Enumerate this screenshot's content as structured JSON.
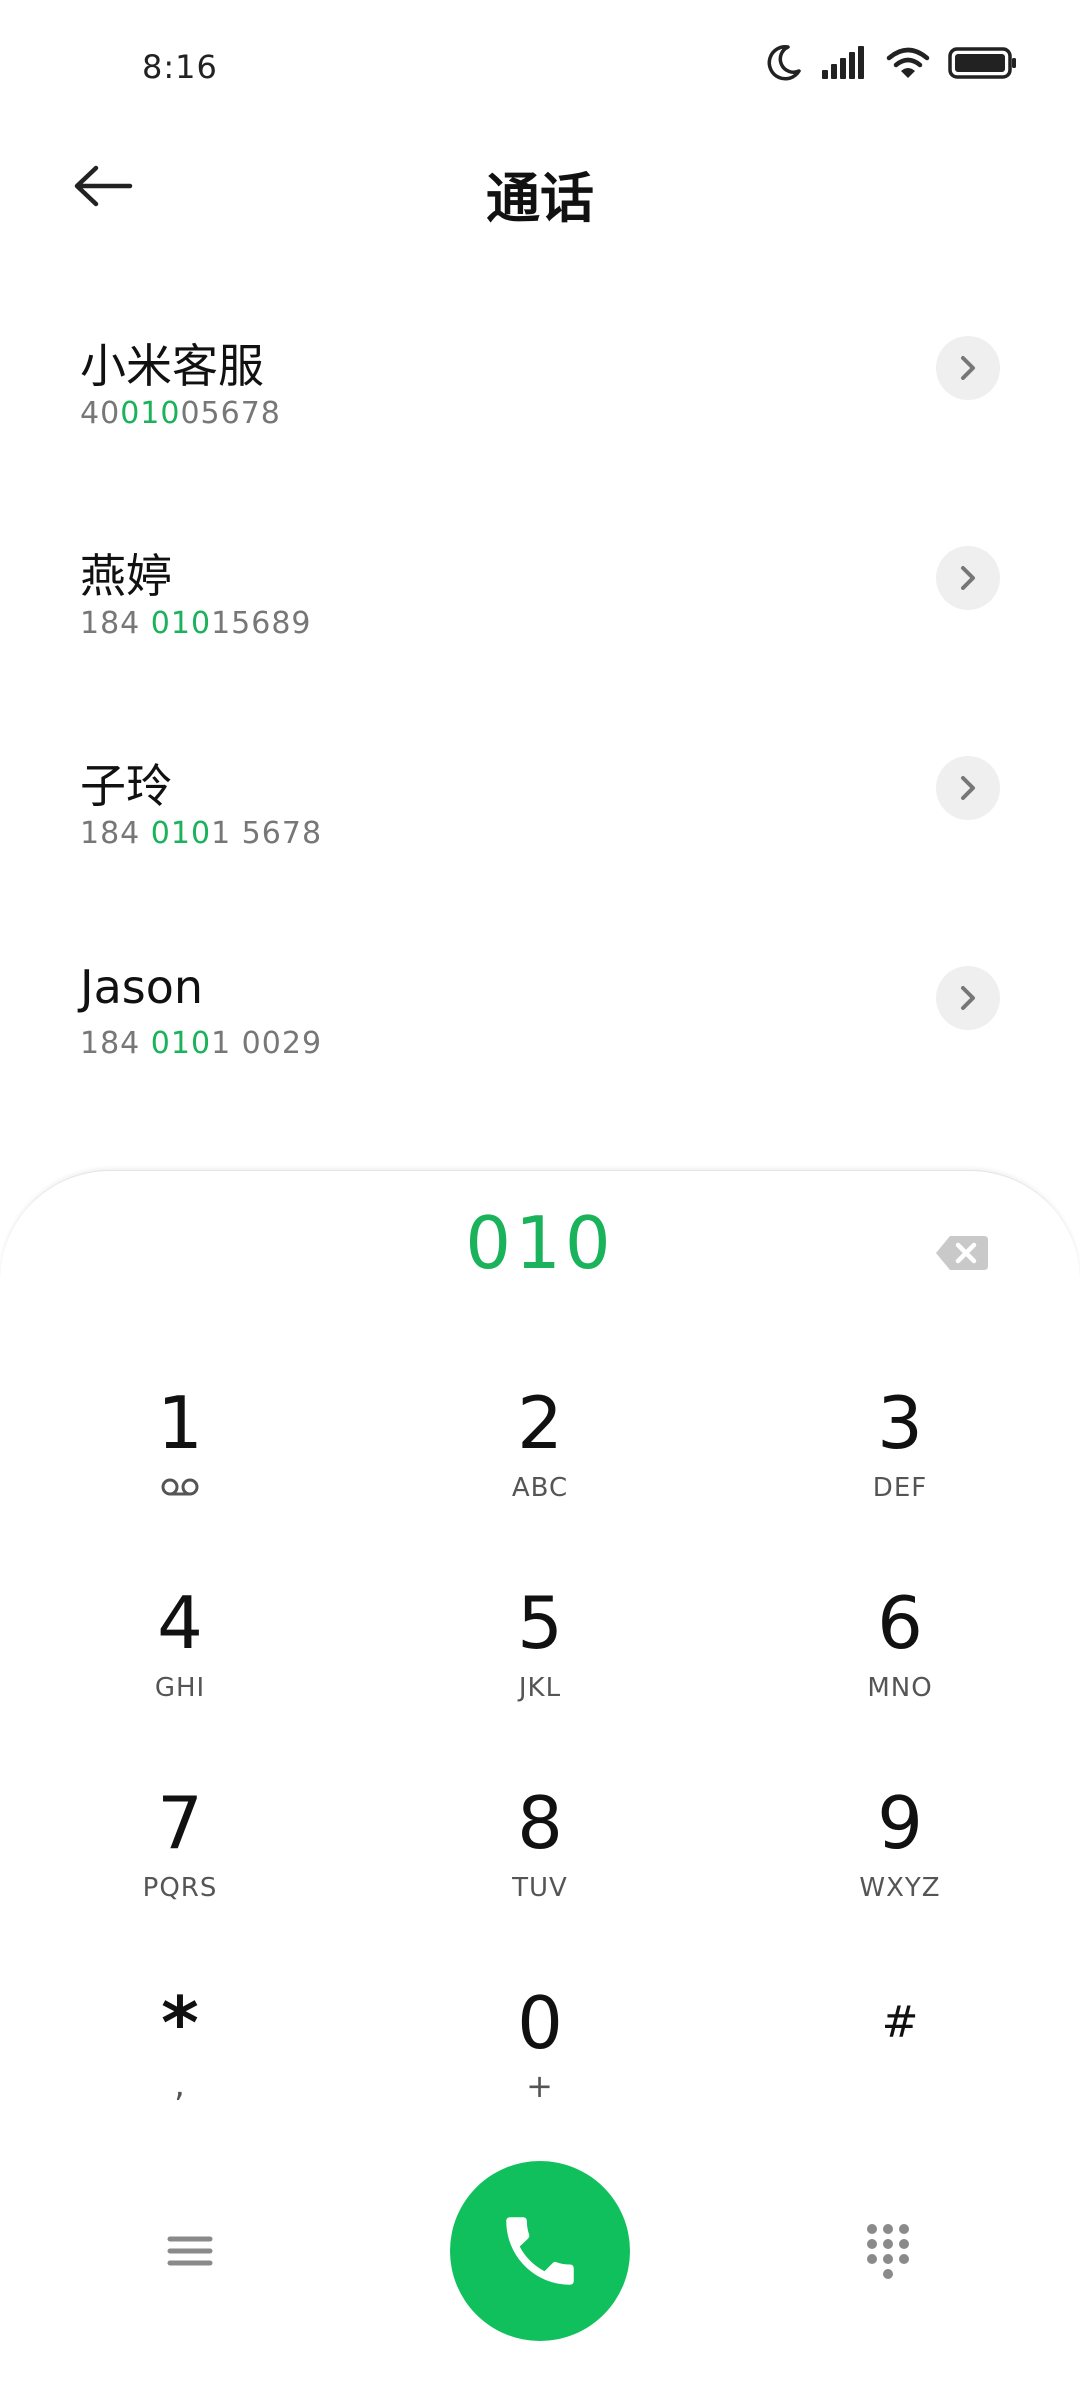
{
  "status_bar": {
    "time": "8:16",
    "icons": [
      "moon-icon",
      "signal-icon",
      "wifi-icon",
      "battery-icon"
    ]
  },
  "header": {
    "back_icon": "arrow-left-icon",
    "title": "通话"
  },
  "contacts": [
    {
      "name": "小米客服",
      "number_parts": [
        "40",
        "010",
        "05678"
      ]
    },
    {
      "name": "燕婷",
      "number_parts": [
        "184 ",
        "010",
        "15689"
      ]
    },
    {
      "name": "子玲",
      "number_parts": [
        "184 ",
        "010",
        "1 5678"
      ]
    },
    {
      "name": "Jason",
      "number_parts": [
        "184 ",
        "010",
        "1 0029"
      ]
    }
  ],
  "dialpad": {
    "input": "010",
    "keys": [
      {
        "digit": "1",
        "letters": ""
      },
      {
        "digit": "2",
        "letters": "ABC"
      },
      {
        "digit": "3",
        "letters": "DEF"
      },
      {
        "digit": "4",
        "letters": "GHI"
      },
      {
        "digit": "5",
        "letters": "JKL"
      },
      {
        "digit": "6",
        "letters": "MNO"
      },
      {
        "digit": "7",
        "letters": "PQRS"
      },
      {
        "digit": "8",
        "letters": "TUV"
      },
      {
        "digit": "9",
        "letters": "WXYZ"
      },
      {
        "digit": "*",
        "letters": ","
      },
      {
        "digit": "0",
        "letters": "+"
      },
      {
        "digit": "#",
        "letters": ""
      }
    ]
  },
  "colors": {
    "accent": "#1ab25a",
    "call_button": "#10c05c"
  }
}
